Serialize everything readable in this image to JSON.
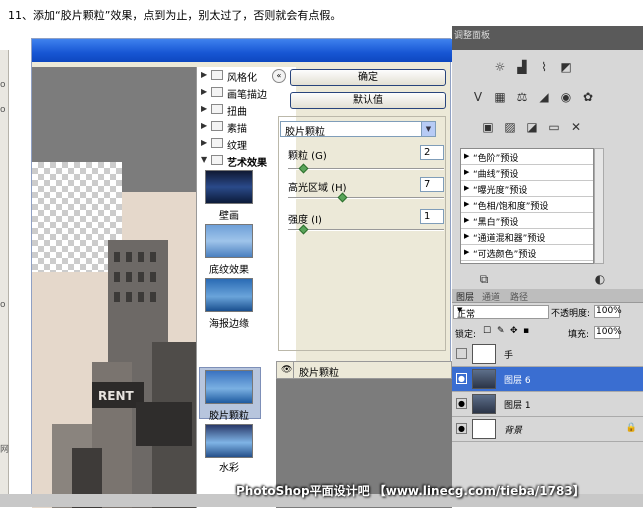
{
  "caption": "11、添加“胶片颗粒”效果，点到为止，别太过了，否则就会有点假。",
  "left_edge_glyphs": [
    "o",
    "o",
    "o",
    "网"
  ],
  "filter_gallery": {
    "scroll_button": "«",
    "categories": [
      {
        "label": "风格化",
        "expanded": false
      },
      {
        "label": "画笔描边",
        "expanded": false
      },
      {
        "label": "扭曲",
        "expanded": false
      },
      {
        "label": "素描",
        "expanded": false
      },
      {
        "label": "纹理",
        "expanded": false
      },
      {
        "label": "艺术效果",
        "expanded": true
      }
    ],
    "thumbnails": [
      {
        "label": "壁画",
        "selected": false
      },
      {
        "label": "底纹效果",
        "selected": false
      },
      {
        "label": "海报边缘",
        "selected": false
      },
      {
        "label": "胶片颗粒",
        "selected": true
      },
      {
        "label": "水彩",
        "selected": false
      }
    ],
    "ok_label": "确定",
    "default_label": "默认值",
    "filter_select": "胶片颗粒",
    "params": [
      {
        "label": "颗粒 (G)",
        "value": "2",
        "level": 0.1
      },
      {
        "label": "高光区域 (H)",
        "value": "7",
        "level": 0.35
      },
      {
        "label": "强度 (I)",
        "value": "1",
        "level": 0.1
      }
    ],
    "effect_layer_label": "胶片颗粒"
  },
  "adjustments": {
    "panel_title": "调整面板",
    "presets": [
      "“色阶”预设",
      "“曲线”预设",
      "“曝光度”预设",
      "“色相/饱和度”预设",
      "“黑白”预设",
      "“通道混和器”预设",
      "“可选颜色”预设"
    ]
  },
  "layers": {
    "tabs": [
      "图层",
      "通道",
      "路径"
    ],
    "blend_mode": "正常",
    "opacity_label": "不透明度:",
    "opacity_value": "100%",
    "lock_label": "锁定:",
    "fill_label": "填充:",
    "fill_value": "100%",
    "items": [
      {
        "name": "手",
        "visible": false,
        "selected": false
      },
      {
        "name": "图层 6",
        "visible": true,
        "selected": true
      },
      {
        "name": "图层 1",
        "visible": true,
        "selected": false
      },
      {
        "name": "背景",
        "visible": true,
        "selected": false,
        "locked": true
      }
    ]
  },
  "watermark": "PhotoShop平面设计吧 【www.linecg.com/tieba/1783】",
  "colors": {
    "title_blue": "#1756d4",
    "selection_blue": "#3a6ed1",
    "slider_green": "#5aa55a"
  }
}
